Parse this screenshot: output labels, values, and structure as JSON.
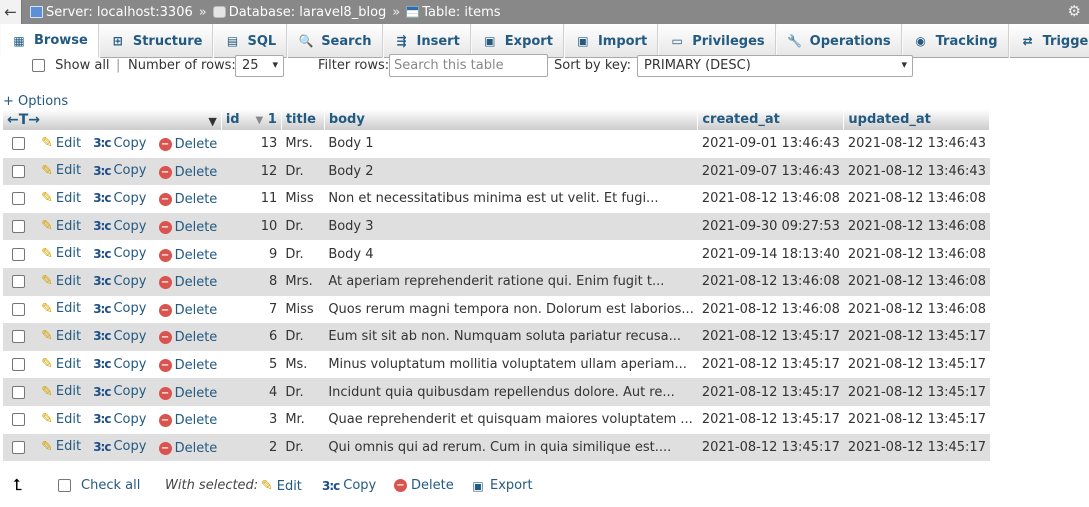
{
  "breadcrumb": {
    "server": "Server: localhost:3306",
    "database": "Database: laravel8_blog",
    "table": "Table: items",
    "separator": "»"
  },
  "tabs": [
    {
      "label": "Browse",
      "icon": "browse-icon",
      "active": true
    },
    {
      "label": "Structure",
      "icon": "structure-icon"
    },
    {
      "label": "SQL",
      "icon": "sql-icon"
    },
    {
      "label": "Search",
      "icon": "search-icon"
    },
    {
      "label": "Insert",
      "icon": "insert-icon"
    },
    {
      "label": "Export",
      "icon": "export-icon"
    },
    {
      "label": "Import",
      "icon": "import-icon"
    },
    {
      "label": "Privileges",
      "icon": "privileges-icon"
    },
    {
      "label": "Operations",
      "icon": "operations-icon"
    },
    {
      "label": "Tracking",
      "icon": "tracking-icon"
    },
    {
      "label": "Triggers",
      "icon": "triggers-icon"
    }
  ],
  "controls": {
    "show_all": "Show all",
    "number_of_rows_label": "Number of rows:",
    "number_of_rows_value": "25",
    "filter_rows_label": "Filter rows:",
    "filter_placeholder": "Search this table",
    "sort_by_key_label": "Sort by key:",
    "sort_by_key_value": "PRIMARY (DESC)"
  },
  "options_link": "+ Options",
  "columns": {
    "id": "id",
    "id_sort_rank": "1",
    "title": "title",
    "body": "body",
    "created_at": "created_at",
    "updated_at": "updated_at"
  },
  "actions": {
    "edit": "Edit",
    "copy": "Copy",
    "delete": "Delete"
  },
  "rows": [
    {
      "id": "13",
      "title": "Mrs.",
      "body": "Body 1",
      "created_at": "2021-09-01 13:46:43",
      "updated_at": "2021-08-12 13:46:43"
    },
    {
      "id": "12",
      "title": "Dr.",
      "body": "Body 2",
      "created_at": "2021-09-07 13:46:43",
      "updated_at": "2021-08-12 13:46:43"
    },
    {
      "id": "11",
      "title": "Miss",
      "body": "Non et necessitatibus minima est ut velit. Et fugi...",
      "created_at": "2021-08-12 13:46:08",
      "updated_at": "2021-08-12 13:46:08"
    },
    {
      "id": "10",
      "title": "Dr.",
      "body": "Body 3",
      "created_at": "2021-09-30 09:27:53",
      "updated_at": "2021-08-12 13:46:08"
    },
    {
      "id": "9",
      "title": "Dr.",
      "body": "Body 4",
      "created_at": "2021-09-14 18:13:40",
      "updated_at": "2021-08-12 13:46:08"
    },
    {
      "id": "8",
      "title": "Mrs.",
      "body": "At aperiam reprehenderit ratione qui. Enim fugit t...",
      "created_at": "2021-08-12 13:46:08",
      "updated_at": "2021-08-12 13:46:08"
    },
    {
      "id": "7",
      "title": "Miss",
      "body": "Quos rerum magni tempora non. Dolorum est laborios...",
      "created_at": "2021-08-12 13:46:08",
      "updated_at": "2021-08-12 13:46:08"
    },
    {
      "id": "6",
      "title": "Dr.",
      "body": "Eum sit sit ab non. Numquam soluta pariatur recusa...",
      "created_at": "2021-08-12 13:45:17",
      "updated_at": "2021-08-12 13:45:17"
    },
    {
      "id": "5",
      "title": "Ms.",
      "body": "Minus voluptatum mollitia voluptatem ullam aperiam...",
      "created_at": "2021-08-12 13:45:17",
      "updated_at": "2021-08-12 13:45:17"
    },
    {
      "id": "4",
      "title": "Dr.",
      "body": "Incidunt quia quibusdam repellendus dolore. Aut re...",
      "created_at": "2021-08-12 13:45:17",
      "updated_at": "2021-08-12 13:45:17"
    },
    {
      "id": "3",
      "title": "Mr.",
      "body": "Quae reprehenderit et quisquam maiores voluptatem ...",
      "created_at": "2021-08-12 13:45:17",
      "updated_at": "2021-08-12 13:45:17"
    },
    {
      "id": "2",
      "title": "Dr.",
      "body": "Qui omnis qui ad rerum. Cum in quia similique est....",
      "created_at": "2021-08-12 13:45:17",
      "updated_at": "2021-08-12 13:45:17"
    }
  ],
  "footer": {
    "check_all": "Check all",
    "with_selected": "With selected:",
    "edit": "Edit",
    "copy": "Copy",
    "delete": "Delete",
    "export": "Export"
  },
  "colors": {
    "link": "#235a81",
    "topbar": "#888888",
    "row_alt": "#dfdfdf",
    "delete_red": "#d9534f"
  }
}
